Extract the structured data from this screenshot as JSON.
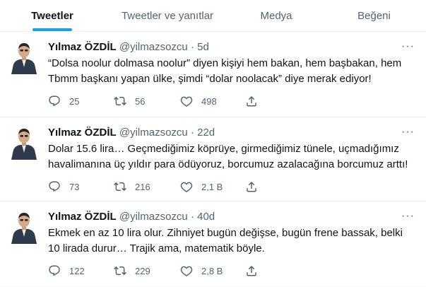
{
  "tabs": [
    "Tweetler",
    "Tweetler ve yanıtlar",
    "Medya",
    "Beğeni"
  ],
  "tweets": [
    {
      "name": "Yılmaz ÖZDİL",
      "handle": "@yilmazsozcu",
      "dot": "·",
      "time": "5d",
      "text": "“Dolsa noolur dolmasa noolur” diyen kişiyi hem bakan, hem başbakan, hem Tbmm başkanı yapan ülke, şimdi “dolar noolacak” diye merak ediyor!",
      "replies": "25",
      "retweets": "56",
      "likes": "498"
    },
    {
      "name": "Yılmaz ÖZDİL",
      "handle": "@yilmazsozcu",
      "dot": "·",
      "time": "22d",
      "text": "Dolar 15.6 lira… Geçmediğimiz köprüye, girmediğimiz tünele, uçmadığımız havalimanına üç yıldır para ödüyoruz, borcumuz azalacağına borcumuz arttı!",
      "replies": "73",
      "retweets": "216",
      "likes": "2,1 B"
    },
    {
      "name": "Yılmaz ÖZDİL",
      "handle": "@yilmazsozcu",
      "dot": "·",
      "time": "40d",
      "text": "Ekmek en az 10 lira olur. Zihniyet bugün değişse, bugün frene bassak, belki 10 lirada durur… Trajik ama, matematik böyle.",
      "replies": "122",
      "retweets": "229",
      "likes": "2,8 B"
    }
  ],
  "more_label": "···",
  "colors": {
    "accent": "#1d9bf0",
    "muted": "#536471",
    "text": "#0f1419",
    "border": "#eff3f4"
  }
}
